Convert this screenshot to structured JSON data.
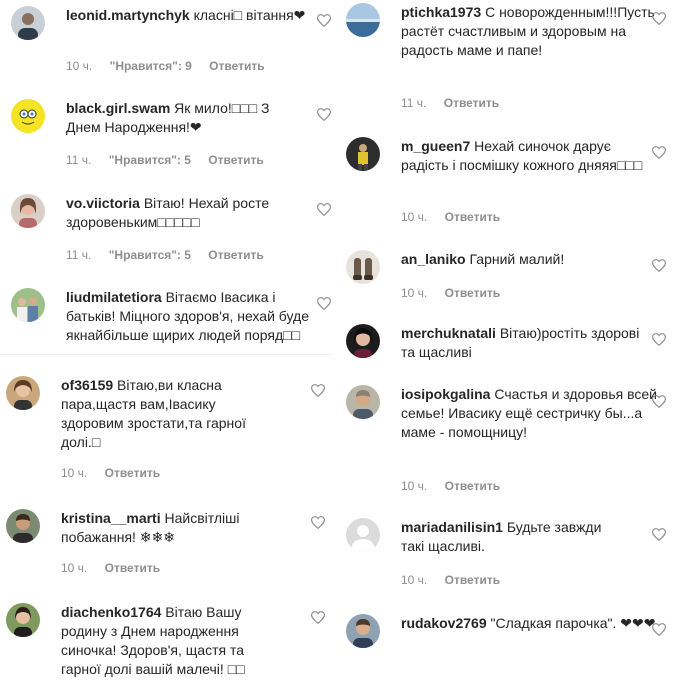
{
  "ui": {
    "like_label": "\"Нравится\"",
    "reply_label": "Ответить"
  },
  "left": [
    {
      "user": "leonid.martynchyk",
      "text": "класні□ вітання❤",
      "time": "10 ч.",
      "likes": "\"Нравится\": 9"
    },
    {
      "user": "black.girl.swam",
      "text": "Як мило!□□□ З Днем Народження!❤",
      "time": "11 ч.",
      "likes": "\"Нравится\": 5"
    },
    {
      "user": "vo.viictoria",
      "text": "Вітаю! Нехай росте здоровеньким□□□□□",
      "time": "11 ч.",
      "likes": "\"Нравится\": 5"
    },
    {
      "user": "liudmilatetiora",
      "text": "Вітаємо Івасика і батьків! Міцного здоров'я, нехай буде якнайбільше щирих людей поряд□□",
      "time": "",
      "likes": ""
    },
    {
      "user": "of36159",
      "text": "Вітаю,ви класна пара,щастя вам,Івасику здоровим зростати,та гарної долі.□",
      "time": "10 ч.",
      "likes": ""
    },
    {
      "user": "kristina__marti",
      "text": "Найсвітліші побажання! ❄❄❄",
      "time": "10 ч.",
      "likes": ""
    },
    {
      "user": "diachenko1764",
      "text": "Вітаю Вашу родину з Днем народження синочка! Здоров'я, щастя та гарної долі вашій малечі! □□",
      "time": "",
      "likes": ""
    }
  ],
  "right": [
    {
      "user": "ptichka1973",
      "text": "С новорожденным!!!Пусть растёт счастливым и здоровым на радость маме и папе!",
      "time": "11 ч.",
      "likes": ""
    },
    {
      "user": "m_gueen7",
      "text": "Нехай синочок дарує радість і посмішку кожного дняяя□□□",
      "time": "10 ч.",
      "likes": ""
    },
    {
      "user": "an_laniko",
      "text": "Гарний малий!",
      "time": "10 ч.",
      "likes": ""
    },
    {
      "user": "merchuknatali",
      "text": "Вітаю)ростіть здорові та щасливі",
      "time": "10 ч.",
      "likes": ""
    },
    {
      "user": "iosipokgalina",
      "text": "Счастья и здоровья всей семье! Ивасику ещё сестричку бы...а маме - помощницу!",
      "time": "10 ч.",
      "likes": ""
    },
    {
      "user": "mariadanilisin1",
      "text": "Будьте завжди такі щасливі.",
      "time": "10 ч.",
      "likes": ""
    },
    {
      "user": "rudakov2769",
      "text": "\"Сладкая парочка\". ❤❤❤",
      "time": "",
      "likes": ""
    }
  ],
  "avatar_icons": {
    "left": [
      "person-avatar-icon",
      "spongebob-avatar-icon",
      "woman-avatar-icon",
      "group-avatar-icon",
      "woman-avatar-icon",
      "man-avatar-icon",
      "woman-avatar-icon"
    ],
    "right": [
      "sea-avatar-icon",
      "yellow-figure-avatar-icon",
      "shoes-avatar-icon",
      "woman-avatar-icon",
      "man-avatar-icon",
      "default-avatar-icon",
      "man-avatar-icon"
    ]
  },
  "colors": {
    "text": "#262626",
    "meta": "#8e8e8e",
    "heart": "#8e8e8e"
  }
}
